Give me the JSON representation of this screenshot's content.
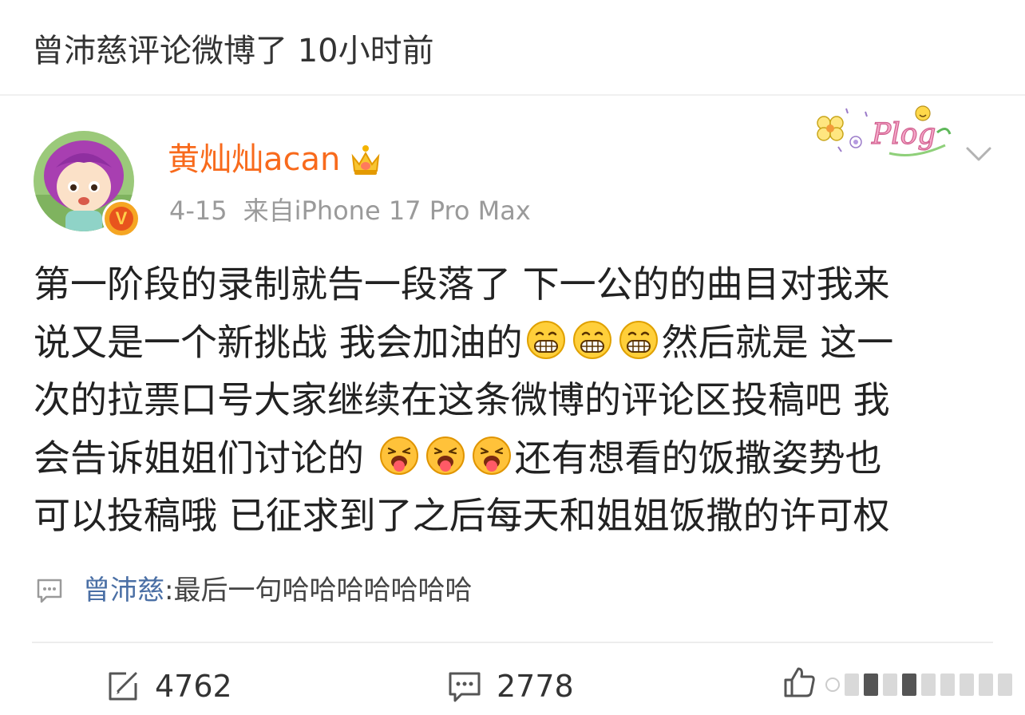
{
  "activity": "曾沛慈评论微博了 10小时前",
  "post": {
    "username": "黄灿灿acan",
    "date": "4-15",
    "source": "来自iPhone 17 Pro Max",
    "sticker_text": "Plog",
    "lines": [
      "第一阶段的录制就告一段落了 下一公的的曲目对我来",
      "说又是一个新挑战 我会加油的",
      "然后就是 这一",
      "次的拉票口号大家继续在这条微博的评论区投稿吧 我",
      "会告诉姐姐们讨论的 ",
      "还有想看的饭撒姿势也",
      "可以投稿哦 已征求到了之后每天和姐姐饭撒的许可权"
    ],
    "emojis": [
      "grin-emoji",
      "tongue-emoji"
    ]
  },
  "comment": {
    "user": "曾沛慈",
    "separator": ": ",
    "text": "最后一句哈哈哈哈哈哈哈"
  },
  "actions": {
    "repost_count": "4762",
    "comment_count": "2778"
  },
  "colors": {
    "username": "#f86a1c",
    "comment_user": "#4a6fa5",
    "meta": "#9a9a9a",
    "body": "#222222"
  }
}
